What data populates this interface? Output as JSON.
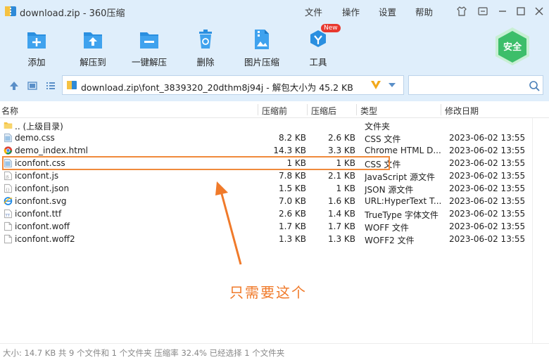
{
  "window": {
    "title": "download.zip - 360压缩",
    "menu": [
      "文件",
      "操作",
      "设置",
      "帮助"
    ]
  },
  "toolbar": {
    "add": "添加",
    "extract_to": "解压到",
    "one_click_extract": "一键解压",
    "delete": "删除",
    "image_compress": "图片压缩",
    "tools": "工具",
    "new_badge": "New",
    "safe_badge": "安全"
  },
  "address": {
    "path": "download.zip\\font_3839320_20dthm8j94j - 解包大小为 45.2 KB"
  },
  "columns": {
    "name": "名称",
    "size": "压缩前",
    "csize": "压缩后",
    "type": "类型",
    "date": "修改日期"
  },
  "files": [
    {
      "name": ".. (上级目录)",
      "size": "",
      "csize": "",
      "type": "文件夹",
      "date": "",
      "icon": "folder-icon"
    },
    {
      "name": "demo.css",
      "size": "8.2 KB",
      "csize": "2.6 KB",
      "type": "CSS 文件",
      "date": "2023-06-02 13:55",
      "icon": "css-file-icon"
    },
    {
      "name": "demo_index.html",
      "size": "14.3 KB",
      "csize": "3.3 KB",
      "type": "Chrome HTML D...",
      "date": "2023-06-02 13:55",
      "icon": "chrome-icon"
    },
    {
      "name": "iconfont.css",
      "size": "1 KB",
      "csize": "1 KB",
      "type": "CSS 文件",
      "date": "2023-06-02 13:55",
      "icon": "css-file-icon"
    },
    {
      "name": "iconfont.js",
      "size": "7.8 KB",
      "csize": "2.1 KB",
      "type": "JavaScript 源文件",
      "date": "2023-06-02 13:55",
      "icon": "js-file-icon"
    },
    {
      "name": "iconfont.json",
      "size": "1.5 KB",
      "csize": "1 KB",
      "type": "JSON 源文件",
      "date": "2023-06-02 13:55",
      "icon": "json-file-icon"
    },
    {
      "name": "iconfont.svg",
      "size": "7.0 KB",
      "csize": "1.6 KB",
      "type": "URL:HyperText T...",
      "date": "2023-06-02 13:55",
      "icon": "ie-icon"
    },
    {
      "name": "iconfont.ttf",
      "size": "2.6 KB",
      "csize": "1.4 KB",
      "type": "TrueType 字体文件",
      "date": "2023-06-02 13:55",
      "icon": "font-file-icon"
    },
    {
      "name": "iconfont.woff",
      "size": "1.7 KB",
      "csize": "1.7 KB",
      "type": "WOFF 文件",
      "date": "2023-06-02 13:55",
      "icon": "file-icon"
    },
    {
      "name": "iconfont.woff2",
      "size": "1.3 KB",
      "csize": "1.3 KB",
      "type": "WOFF2 文件",
      "date": "2023-06-02 13:55",
      "icon": "file-icon"
    }
  ],
  "annotation": "只需要这个",
  "status": "大小: 14.7 KB 共 9 个文件和 1 个文件夹 压缩率 32.4% 已经选择 1 个文件夹",
  "colors": {
    "accent": "#1a8ad8",
    "highlight": "#f08a3c",
    "safe": "#3dbe6a"
  }
}
